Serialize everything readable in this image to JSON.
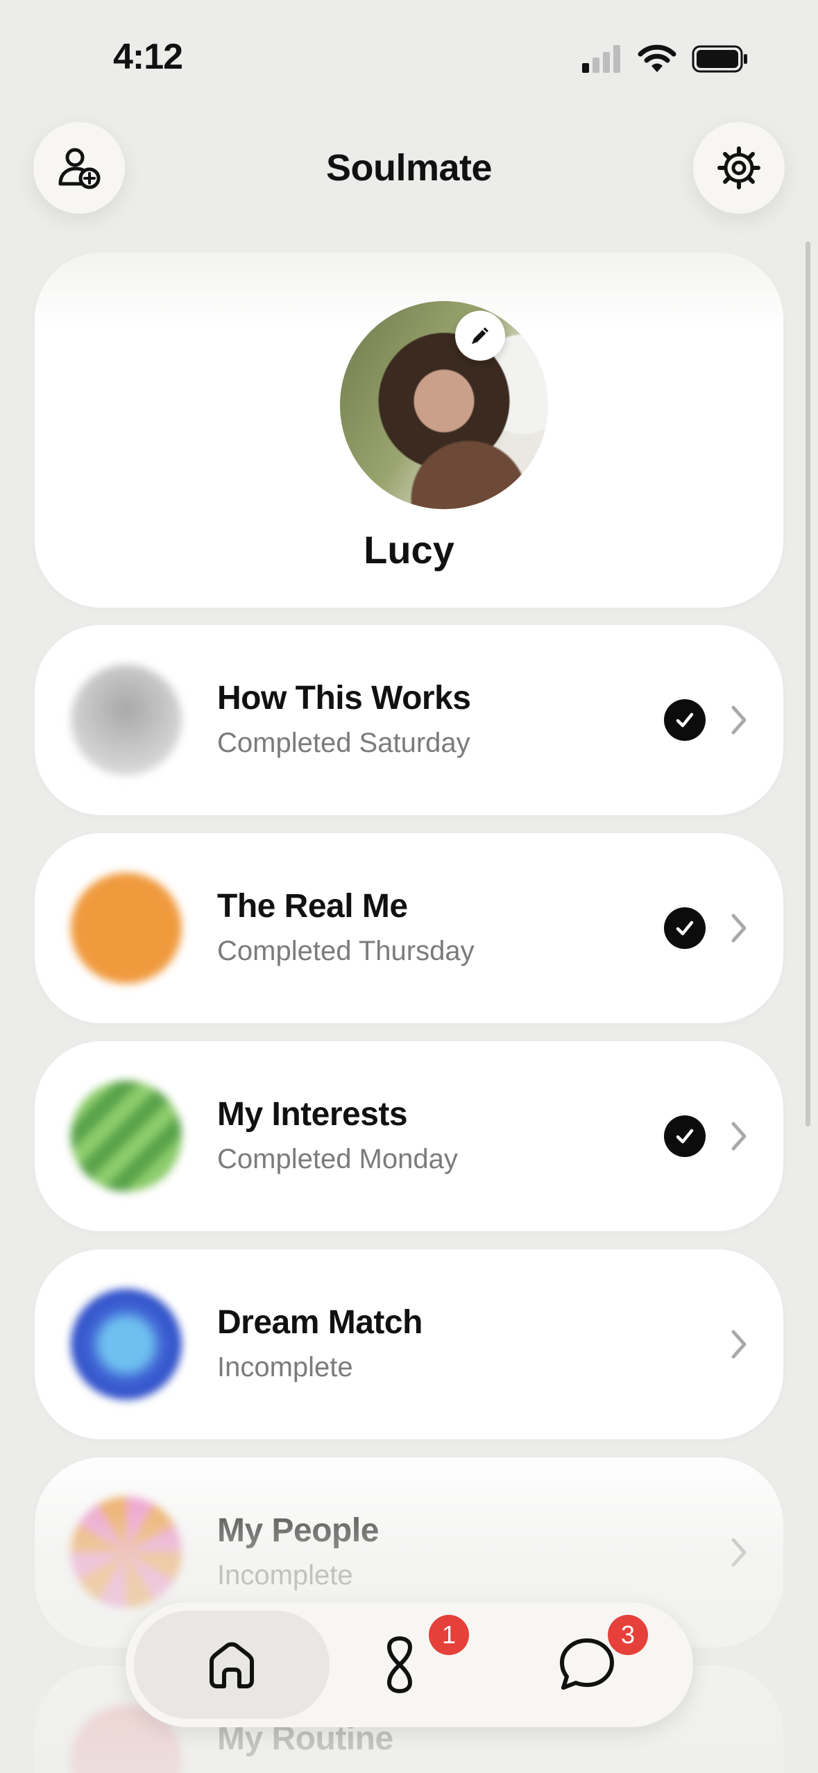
{
  "status_bar": {
    "time": "4:12"
  },
  "header": {
    "title": "Soulmate"
  },
  "profile": {
    "name": "Lucy"
  },
  "sections": [
    {
      "title": "How This Works",
      "subtitle": "Completed Saturday",
      "completed": true,
      "orb": "gray"
    },
    {
      "title": "The Real Me",
      "subtitle": "Completed Thursday",
      "completed": true,
      "orb": "orange"
    },
    {
      "title": "My Interests",
      "subtitle": "Completed Monday",
      "completed": true,
      "orb": "green-striped"
    },
    {
      "title": "Dream Match",
      "subtitle": "Incomplete",
      "completed": false,
      "orb": "blue"
    },
    {
      "title": "My People",
      "subtitle": "Incomplete",
      "completed": false,
      "orb": "pink-orange"
    },
    {
      "title": "My Routine",
      "orb": "red"
    }
  ],
  "tab_bar": {
    "tabs": [
      {
        "name": "home",
        "icon": "home-icon",
        "selected": true
      },
      {
        "name": "matches",
        "icon": "infinity-icon",
        "badge": "1"
      },
      {
        "name": "messages",
        "icon": "chat-bubble-icon",
        "badge": "3"
      }
    ]
  },
  "colors": {
    "badge": "#e5403a",
    "check": "#0c0c0c",
    "background": "#ececea"
  }
}
